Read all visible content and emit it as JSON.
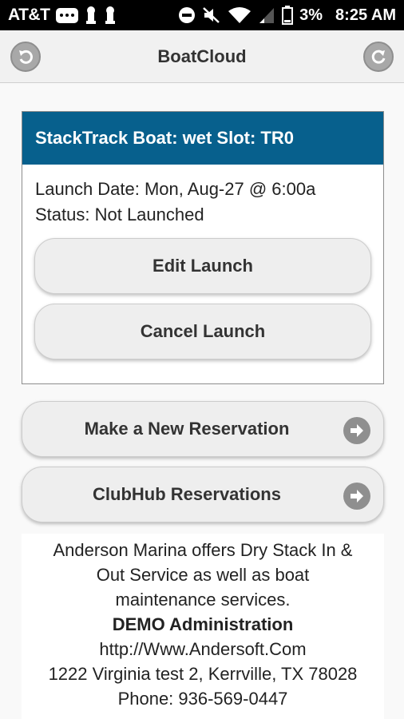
{
  "status_bar": {
    "carrier": "AT&T",
    "battery": "3%",
    "time": "8:25 AM"
  },
  "header": {
    "title": "BoatCloud",
    "back_icon": "back-arrow-icon",
    "refresh_icon": "refresh-icon"
  },
  "card": {
    "title": "StackTrack Boat: wet Slot: TR0",
    "launch_date": "Launch Date: Mon, Aug-27 @ 6:00a",
    "status": "Status: Not Launched",
    "edit_label": "Edit Launch",
    "cancel_label": "Cancel Launch"
  },
  "actions": {
    "new_reservation": "Make a New Reservation",
    "clubhub": "ClubHub Reservations"
  },
  "info": {
    "line1": "Anderson Marina offers Dry Stack In &",
    "line2": "Out Service as well as boat",
    "line3": "maintenance services.",
    "company": "DEMO Administration",
    "website": "http://Www.Andersoft.Com",
    "address": "1222 Virginia test 2, Kerrville, TX 78028",
    "phone": "Phone: 936-569-0447"
  },
  "colors": {
    "card_header": "#07608d",
    "status_bar": "#000000",
    "button_bg": "#eeeeee",
    "icon_gray": "#8f8f8f"
  }
}
